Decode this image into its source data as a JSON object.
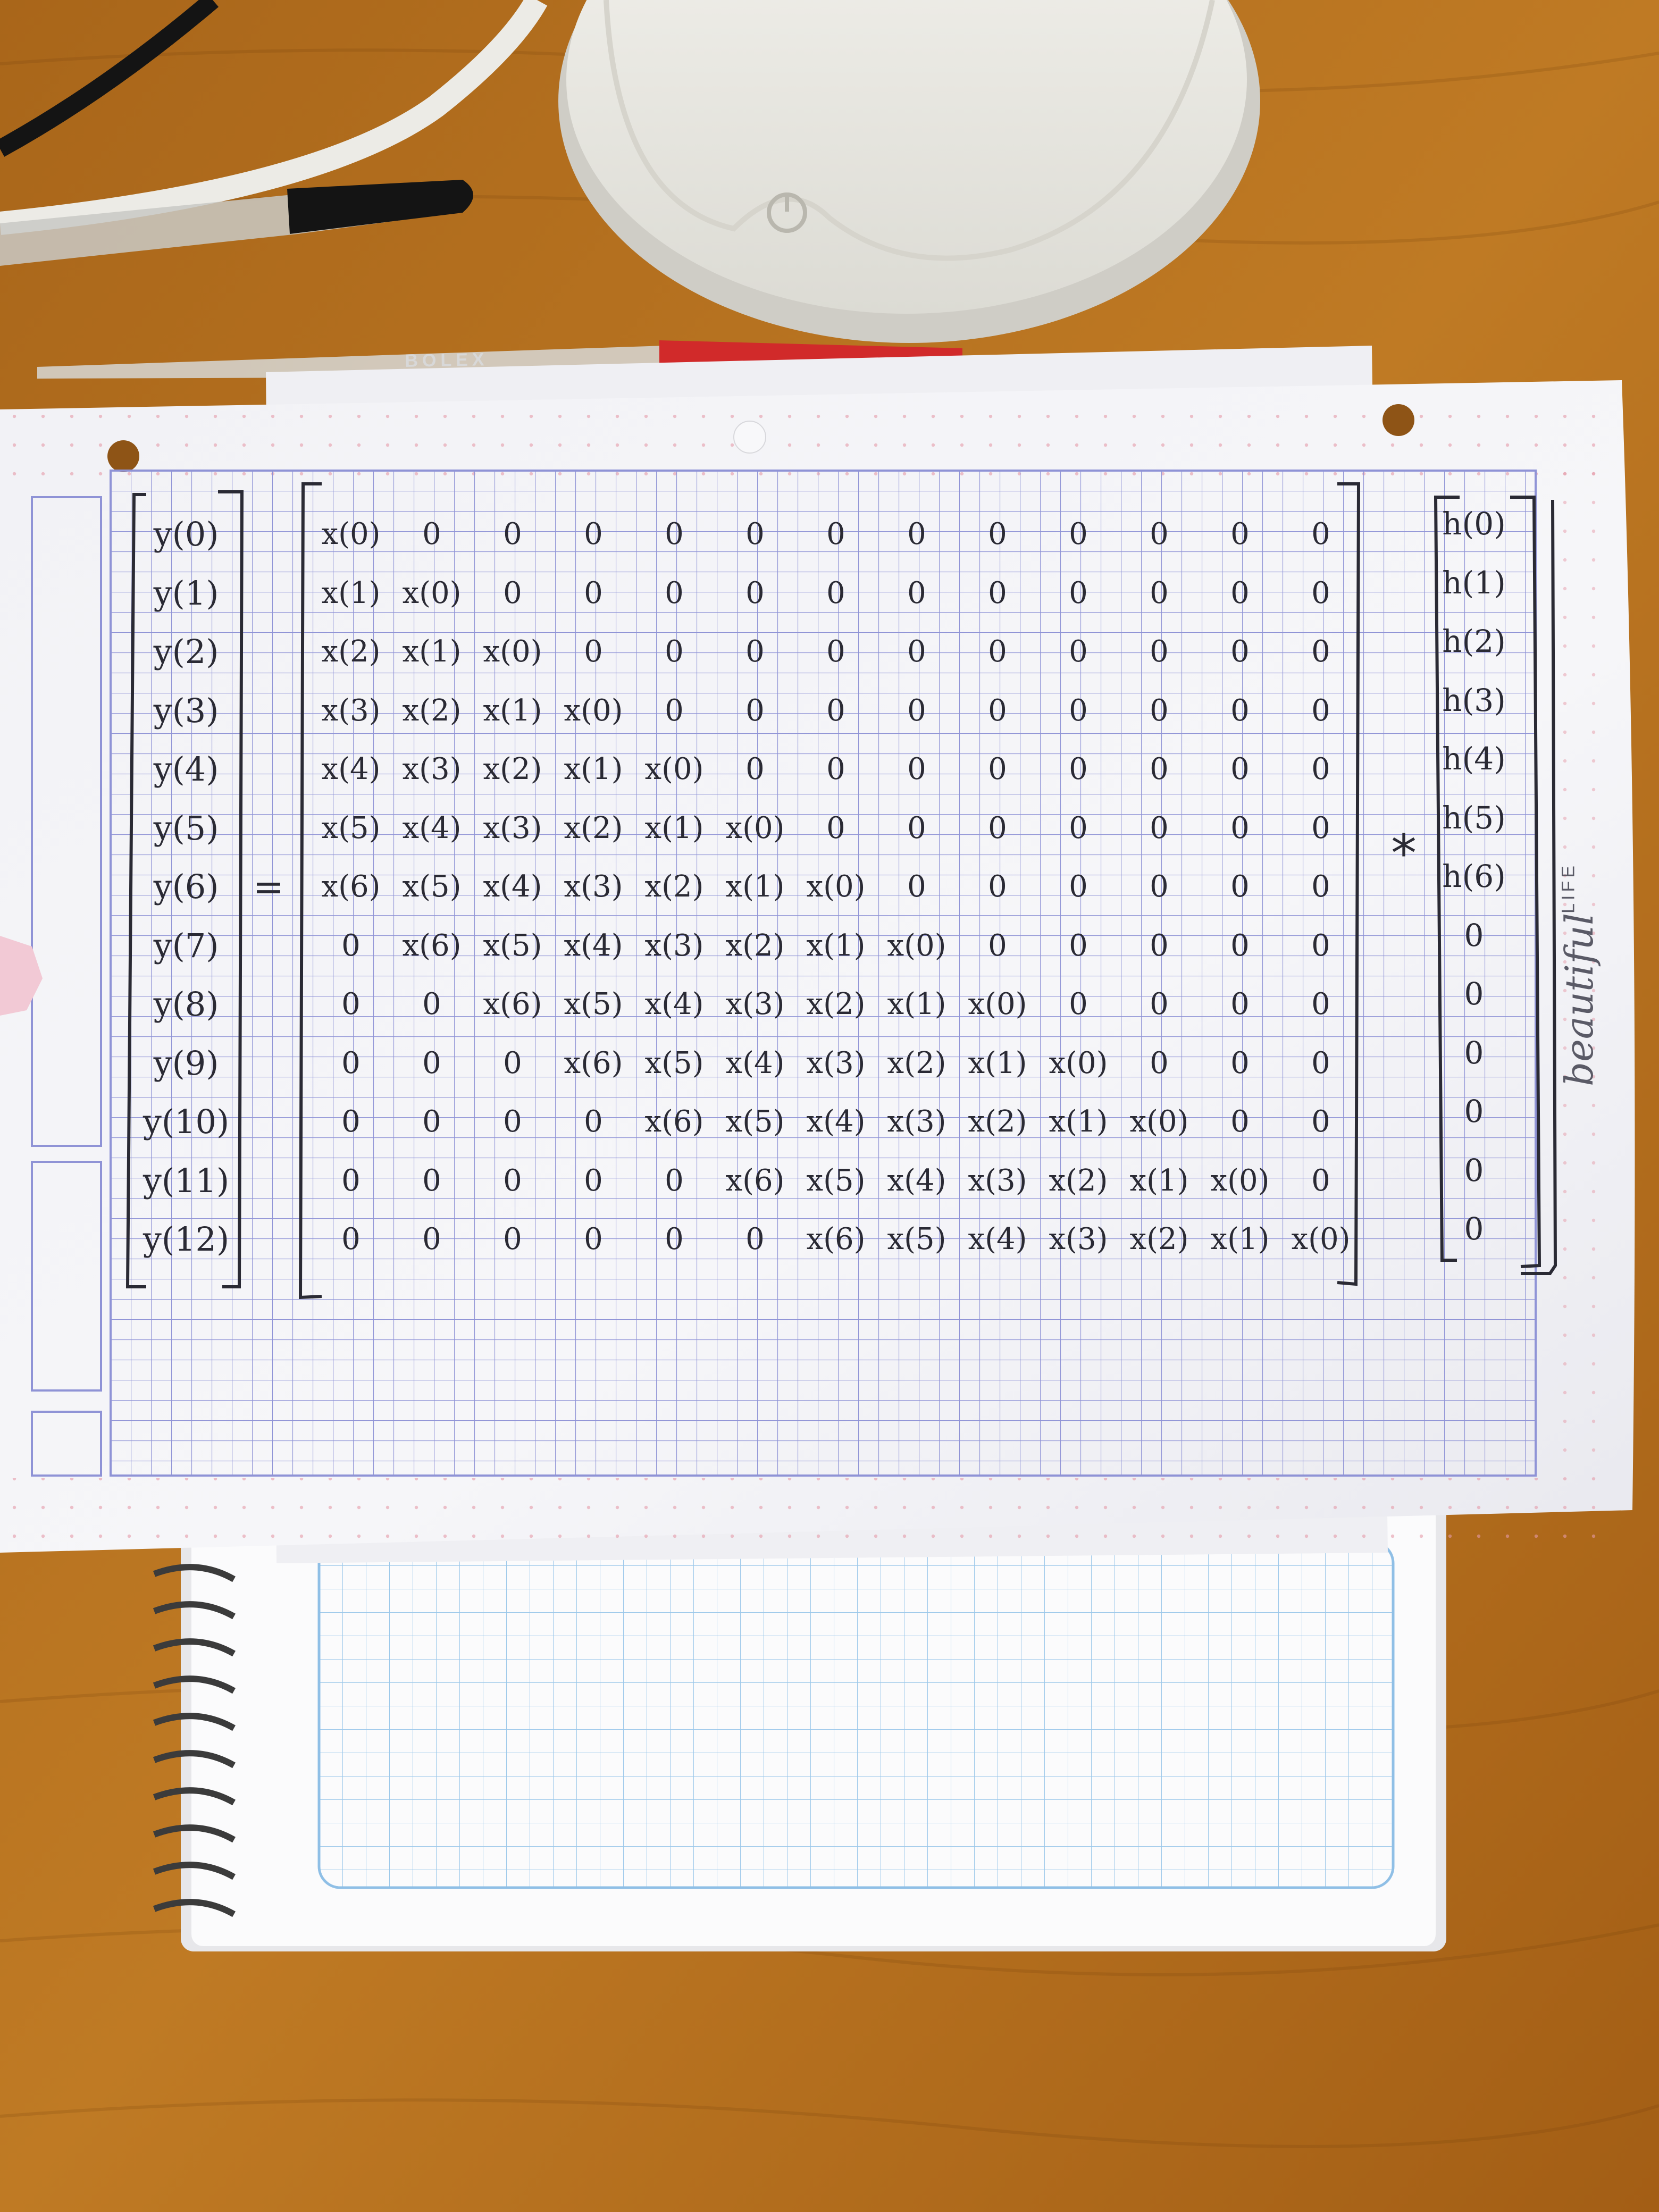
{
  "equation": {
    "y_vector": [
      "y(0)",
      "y(1)",
      "y(2)",
      "y(3)",
      "y(4)",
      "y(5)",
      "y(6)",
      "y(7)",
      "y(8)",
      "y(9)",
      "y(10)",
      "y(11)",
      "y(12)"
    ],
    "equals": "=",
    "matrix_rows": [
      [
        "x(0)",
        "0",
        "0",
        "0",
        "0",
        "0",
        "0",
        "0",
        "0",
        "0",
        "0",
        "0",
        "0"
      ],
      [
        "x(1)",
        "x(0)",
        "0",
        "0",
        "0",
        "0",
        "0",
        "0",
        "0",
        "0",
        "0",
        "0",
        "0"
      ],
      [
        "x(2)",
        "x(1)",
        "x(0)",
        "0",
        "0",
        "0",
        "0",
        "0",
        "0",
        "0",
        "0",
        "0",
        "0"
      ],
      [
        "x(3)",
        "x(2)",
        "x(1)",
        "x(0)",
        "0",
        "0",
        "0",
        "0",
        "0",
        "0",
        "0",
        "0",
        "0"
      ],
      [
        "x(4)",
        "x(3)",
        "x(2)",
        "x(1)",
        "x(0)",
        "0",
        "0",
        "0",
        "0",
        "0",
        "0",
        "0",
        "0"
      ],
      [
        "x(5)",
        "x(4)",
        "x(3)",
        "x(2)",
        "x(1)",
        "x(0)",
        "0",
        "0",
        "0",
        "0",
        "0",
        "0",
        "0"
      ],
      [
        "x(6)",
        "x(5)",
        "x(4)",
        "x(3)",
        "x(2)",
        "x(1)",
        "x(0)",
        "0",
        "0",
        "0",
        "0",
        "0",
        "0"
      ],
      [
        "0",
        "x(6)",
        "x(5)",
        "x(4)",
        "x(3)",
        "x(2)",
        "x(1)",
        "x(0)",
        "0",
        "0",
        "0",
        "0",
        "0"
      ],
      [
        "0",
        "0",
        "x(6)",
        "x(5)",
        "x(4)",
        "x(3)",
        "x(2)",
        "x(1)",
        "x(0)",
        "0",
        "0",
        "0",
        "0"
      ],
      [
        "0",
        "0",
        "0",
        "x(6)",
        "x(5)",
        "x(4)",
        "x(3)",
        "x(2)",
        "x(1)",
        "x(0)",
        "0",
        "0",
        "0"
      ],
      [
        "0",
        "0",
        "0",
        "0",
        "x(6)",
        "x(5)",
        "x(4)",
        "x(3)",
        "x(2)",
        "x(1)",
        "x(0)",
        "0",
        "0"
      ],
      [
        "0",
        "0",
        "0",
        "0",
        "0",
        "x(6)",
        "x(5)",
        "x(4)",
        "x(3)",
        "x(2)",
        "x(1)",
        "x(0)",
        "0"
      ],
      [
        "0",
        "0",
        "0",
        "0",
        "0",
        "0",
        "x(6)",
        "x(5)",
        "x(4)",
        "x(3)",
        "x(2)",
        "x(1)",
        "x(0)"
      ]
    ],
    "operator": "*",
    "h_vector": [
      "h(0)",
      "h(1)",
      "h(2)",
      "h(3)",
      "h(4)",
      "h(5)",
      "h(6)",
      "0",
      "0",
      "0",
      "0",
      "0",
      "0"
    ]
  },
  "paper_branding": {
    "script": "beautiful",
    "caps": "LIFE"
  },
  "pen_imprint": "BOLEX",
  "colors": {
    "desk": "#b8741f",
    "paper": "#f3f3f6",
    "grid_ink": "#8f93d6",
    "notebook_grid": "#8fbfe6",
    "handwriting": "#2a2a34",
    "red_dots": "#e59aa8"
  }
}
